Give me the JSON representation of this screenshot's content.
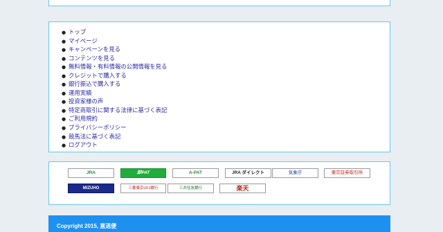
{
  "links": [
    "トップ",
    "マイページ",
    "キャンペーンを見る",
    "コンテンツを見る",
    "無料情報・有料情報の公開情報を見る",
    "クレジットで購入する",
    "銀行振込で購入する",
    "運用実績",
    "投資家様の声",
    "特定商取引に関する法律に基づく表記",
    "ご利用規約",
    "プライバシーポリシー",
    "競馬法に基づく表記",
    "ログアウト"
  ],
  "banners": {
    "jra": "JRA",
    "ipat": "即PAT",
    "apat": "A-PAT",
    "direct": "JRA ダイレクト",
    "kishou": "気象庁",
    "tosho": "東京証券取引所",
    "mizuho": "MIZUHO",
    "mufg": "三菱東京UFJ銀行",
    "smbc": "三井住友銀行",
    "rakuten": "楽天"
  },
  "footer": {
    "copyright": "Copyright 2015, 直送便"
  },
  "colors": {
    "border": "#64c8f0",
    "footer_bg": "#1e90f0",
    "link": "#2a2aa8",
    "page_bg": "#e8eef2"
  }
}
